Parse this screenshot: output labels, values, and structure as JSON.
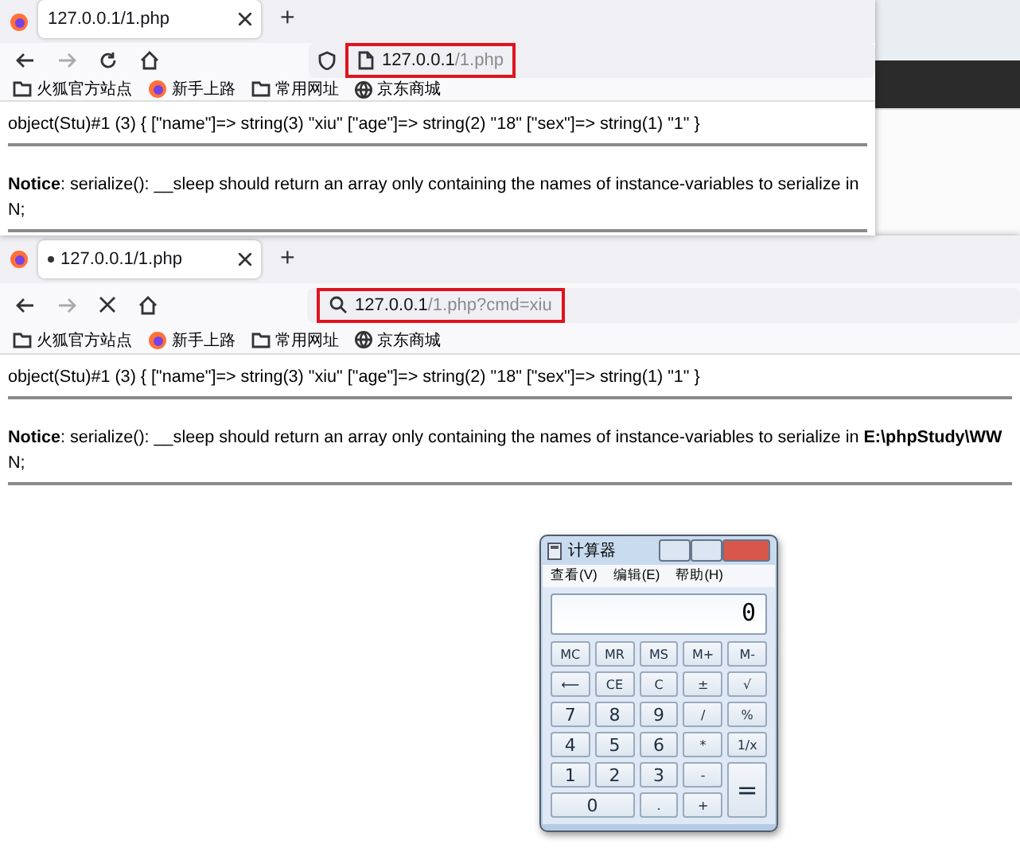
{
  "windows": [
    {
      "tabs": [
        {
          "title": "127.0.0.1/1.php",
          "selected": true,
          "loading": false
        }
      ],
      "new_tab": "+",
      "loading": false,
      "address": {
        "kind": "page",
        "host": "127.0.0.1",
        "path": "/1.php"
      },
      "bookmarks": [
        {
          "kind": "folder",
          "label": "火狐官方站点"
        },
        {
          "kind": "browser",
          "label": "新手上路"
        },
        {
          "kind": "folder",
          "label": "常用网址"
        },
        {
          "kind": "globe",
          "label": "京东商城"
        }
      ],
      "dump": "object(Stu)#1 (3) { [\"name\"]=> string(3) \"xiu\" [\"age\"]=> string(2) \"18\" [\"sex\"]=> string(1) \"1\" }",
      "notice": "**Notice**: serialize(): __sleep should return an array only containing the names of instance-variables to serialize in",
      "notice_end": "N;"
    },
    {
      "tabs": [
        {
          "title": "127.0.0.1/1.php",
          "selected": true,
          "loading": true
        }
      ],
      "new_tab": "+",
      "loading": true,
      "address": {
        "kind": "search",
        "host": "127.0.0.1",
        "path": "/1.php?cmd=xiu"
      },
      "bookmarks": [
        {
          "kind": "folder",
          "label": "火狐官方站点"
        },
        {
          "kind": "browser",
          "label": "新手上路"
        },
        {
          "kind": "folder",
          "label": "常用网址"
        },
        {
          "kind": "globe",
          "label": "京东商城"
        }
      ],
      "dump": "object(Stu)#1 (3) { [\"name\"]=> string(3) \"xiu\" [\"age\"]=> string(2) \"18\" [\"sex\"]=> string(1) \"1\" }",
      "notice": "**Notice**: serialize(): __sleep should return an array only containing the names of instance-variables to serialize in **E:\\phpStudy\\WW**",
      "notice_end": "N;"
    }
  ],
  "calculator": {
    "title": "计算器",
    "menu": [
      "查看(V)",
      "编辑(E)",
      "帮助(H)"
    ],
    "display": "0",
    "keys": [
      {
        "label": "MC",
        "kind": "small"
      },
      {
        "label": "MR",
        "kind": "small"
      },
      {
        "label": "MS",
        "kind": "small"
      },
      {
        "label": "M+",
        "kind": "small"
      },
      {
        "label": "M-",
        "kind": "small"
      },
      {
        "label": "⟵",
        "kind": "small"
      },
      {
        "label": "CE",
        "kind": "small"
      },
      {
        "label": "C",
        "kind": "small"
      },
      {
        "label": "±",
        "kind": "small"
      },
      {
        "label": "√",
        "kind": "small"
      },
      {
        "label": "7",
        "kind": "digit"
      },
      {
        "label": "8",
        "kind": "digit"
      },
      {
        "label": "9",
        "kind": "digit"
      },
      {
        "label": "/",
        "kind": "small"
      },
      {
        "label": "%",
        "kind": "small"
      },
      {
        "label": "4",
        "kind": "digit"
      },
      {
        "label": "5",
        "kind": "digit"
      },
      {
        "label": "6",
        "kind": "digit"
      },
      {
        "label": "*",
        "kind": "small"
      },
      {
        "label": "1/x",
        "kind": "small"
      },
      {
        "label": "1",
        "kind": "digit"
      },
      {
        "label": "2",
        "kind": "digit"
      },
      {
        "label": "3",
        "kind": "digit"
      },
      {
        "label": "-",
        "kind": "small"
      },
      {
        "label": "=",
        "kind": "tall"
      },
      {
        "label": "0",
        "kind": "wide"
      },
      {
        "label": ".",
        "kind": "small"
      },
      {
        "label": "+",
        "kind": "small"
      }
    ]
  }
}
